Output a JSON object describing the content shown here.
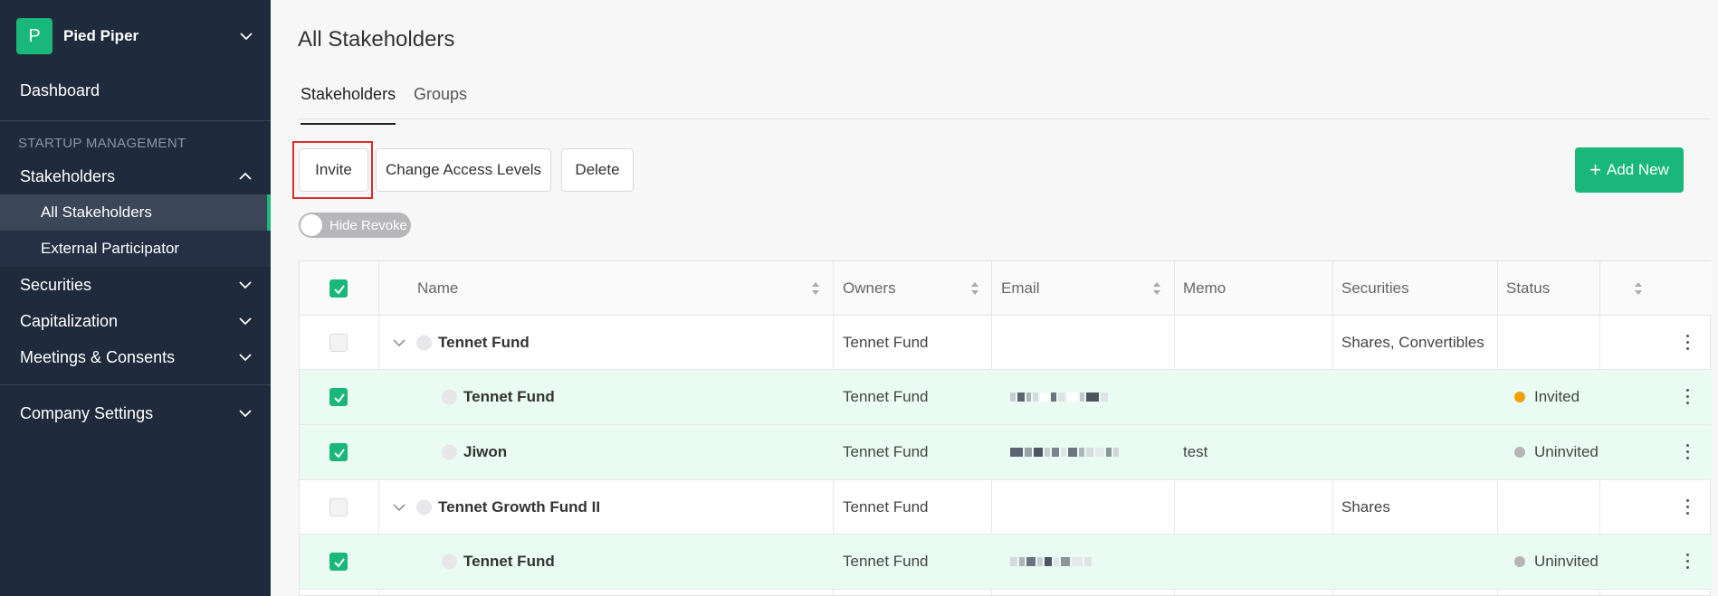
{
  "company": {
    "initial": "P",
    "name": "Pied Piper"
  },
  "nav": {
    "dashboard": "Dashboard",
    "section_title": "STARTUP MANAGEMENT",
    "stakeholders": "Stakeholders",
    "all_stakeholders": "All Stakeholders",
    "external_participator": "External Participator",
    "securities": "Securities",
    "capitalization": "Capitalization",
    "meetings": "Meetings & Consents",
    "company_settings": "Company Settings"
  },
  "page": {
    "title": "All Stakeholders"
  },
  "tabs": [
    {
      "label": "Stakeholders",
      "active": true
    },
    {
      "label": "Groups",
      "active": false
    }
  ],
  "toolbar": {
    "invite_label": "Invite",
    "change_access_label": "Change Access Levels",
    "delete_label": "Delete",
    "add_new_label": "Add New",
    "hide_revoke_label": "Hide Revoke"
  },
  "colors": {
    "accent": "#19b77a",
    "sidebar": "#1f2a3c",
    "highlight": "#e02b2b",
    "invited": "#f0a000",
    "uninvited": "#b5b5b8"
  },
  "table": {
    "headers": [
      "Name",
      "Owners",
      "Email",
      "Memo",
      "Securities",
      "Status"
    ],
    "rows": [
      {
        "name": "Tennet Fund",
        "owners": "Tennet Fund",
        "email": "",
        "memo": "",
        "securities": "Shares, Convertibles",
        "status": "",
        "checked": false,
        "group": true
      },
      {
        "name": "Tennet Fund",
        "owners": "Tennet Fund",
        "email": "",
        "memo": "",
        "securities": "",
        "status": "Invited",
        "checked": true,
        "group": false
      },
      {
        "name": "Jiwon",
        "owners": "Tennet Fund",
        "email": "",
        "memo": "test",
        "securities": "",
        "status": "Uninvited",
        "checked": true,
        "group": false
      },
      {
        "name": "Tennet Growth Fund II",
        "owners": "Tennet Fund",
        "email": "",
        "memo": "",
        "securities": "Shares",
        "status": "",
        "checked": false,
        "group": true
      },
      {
        "name": "Tennet Fund",
        "owners": "Tennet Fund",
        "email": "",
        "memo": "",
        "securities": "",
        "status": "Uninvited",
        "checked": true,
        "group": false
      }
    ]
  }
}
